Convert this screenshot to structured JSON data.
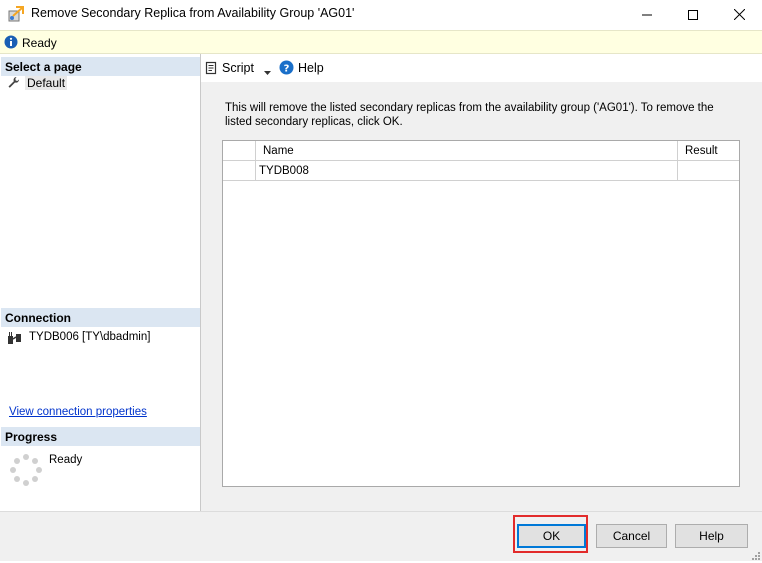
{
  "window": {
    "title": "Remove Secondary Replica from Availability Group 'AG01'"
  },
  "status": {
    "text": "Ready"
  },
  "sidebar": {
    "select_page_header": "Select a page",
    "pages": [
      {
        "label": "Default"
      }
    ],
    "connection_header": "Connection",
    "connection_value": "TYDB006 [TY\\dbadmin]",
    "connection_link": "View connection properties",
    "progress_header": "Progress",
    "progress_status": "Ready"
  },
  "toolbar": {
    "script_label": "Script",
    "help_label": "Help"
  },
  "main": {
    "description": "This will remove the listed secondary replicas from the availability group ('AG01'). To remove the listed secondary replicas, click OK.",
    "grid": {
      "columns": [
        "Name",
        "Result"
      ],
      "rows": [
        {
          "name": "TYDB008",
          "result": ""
        }
      ]
    }
  },
  "buttons": {
    "ok": "OK",
    "cancel": "Cancel",
    "help": "Help"
  },
  "colors": {
    "status_bar": "#ffffe1",
    "section_header": "#dbe6f2",
    "highlight": "#e22b2b",
    "link": "#0033cc"
  }
}
